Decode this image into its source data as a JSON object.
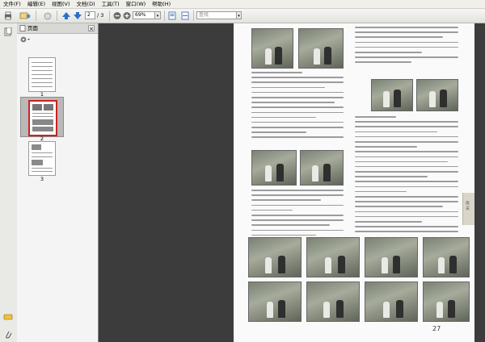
{
  "menu": [
    "文件(F)",
    "编辑(E)",
    "视图(V)",
    "文档(D)",
    "工具(T)",
    "窗口(W)",
    "帮助(H)"
  ],
  "toolbar": {
    "page_current": "2",
    "page_total": "/ 3",
    "zoom": "69%",
    "search_placeholder": "查找"
  },
  "panel": {
    "title": "页面",
    "close": "×",
    "thumbnails": [
      {
        "label": "1",
        "selected": false
      },
      {
        "label": "2",
        "selected": true
      },
      {
        "label": "3",
        "selected": false
      }
    ]
  },
  "document": {
    "page_number": "27",
    "tab_text": "练 关"
  },
  "colors": {
    "selected_thumb": "#cc2222",
    "toolbar_arrow": "#2a6fd1"
  }
}
